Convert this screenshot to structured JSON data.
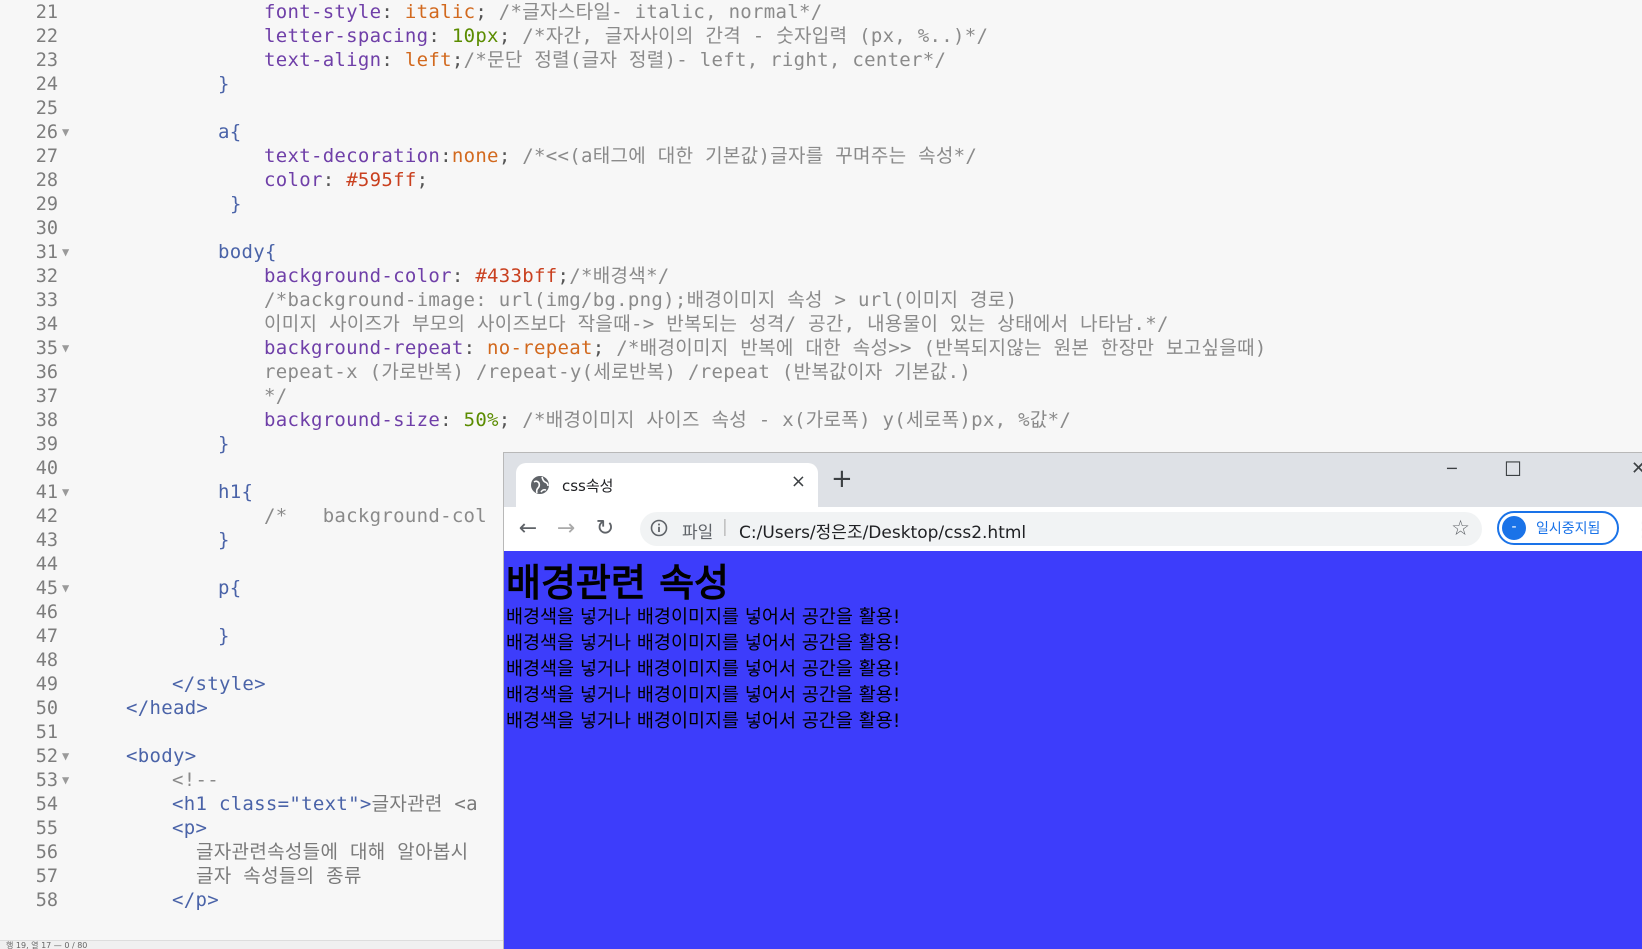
{
  "editor": {
    "lines": [
      {
        "n": "21",
        "fold": false,
        "indent": 264,
        "tokens": [
          [
            "prop",
            "font-style"
          ],
          [
            "p",
            ": "
          ],
          [
            "val",
            "italic"
          ],
          [
            "p",
            "; "
          ],
          [
            "cmt",
            "/*글자스타일- italic, normal*/"
          ]
        ]
      },
      {
        "n": "22",
        "fold": false,
        "indent": 264,
        "tokens": [
          [
            "prop",
            "letter-spacing"
          ],
          [
            "p",
            ": "
          ],
          [
            "num",
            "10px"
          ],
          [
            "p",
            "; "
          ],
          [
            "cmt",
            "/*자간, 글자사이의 간격 - 숫자입력 (px, %..)*/"
          ]
        ]
      },
      {
        "n": "23",
        "fold": false,
        "indent": 264,
        "tokens": [
          [
            "prop",
            "text-align"
          ],
          [
            "p",
            ": "
          ],
          [
            "val",
            "left"
          ],
          [
            "p",
            ";"
          ],
          [
            "cmt",
            "/*문단 정렬(글자 정렬)- left, right, center*/"
          ]
        ]
      },
      {
        "n": "24",
        "fold": false,
        "indent": 218,
        "tokens": [
          [
            "sel",
            "}"
          ]
        ]
      },
      {
        "n": "25",
        "fold": false,
        "indent": 218,
        "tokens": []
      },
      {
        "n": "26",
        "fold": true,
        "indent": 218,
        "tokens": [
          [
            "sel",
            "a{"
          ]
        ]
      },
      {
        "n": "27",
        "fold": false,
        "indent": 264,
        "tokens": [
          [
            "prop",
            "text-decoration"
          ],
          [
            "p",
            ":"
          ],
          [
            "val",
            "none"
          ],
          [
            "p",
            "; "
          ],
          [
            "cmt",
            "/*<<(a태그에 대한 기본값)글자를 꾸며주는 속성*/"
          ]
        ]
      },
      {
        "n": "28",
        "fold": false,
        "indent": 264,
        "tokens": [
          [
            "prop",
            "color"
          ],
          [
            "p",
            ": "
          ],
          [
            "col",
            "#595ff"
          ],
          [
            "p",
            ";"
          ]
        ]
      },
      {
        "n": "29",
        "fold": false,
        "indent": 230,
        "tokens": [
          [
            "sel",
            "}"
          ]
        ]
      },
      {
        "n": "30",
        "fold": false,
        "indent": 218,
        "tokens": []
      },
      {
        "n": "31",
        "fold": true,
        "indent": 218,
        "tokens": [
          [
            "sel",
            "body{"
          ]
        ]
      },
      {
        "n": "32",
        "fold": false,
        "indent": 264,
        "tokens": [
          [
            "prop",
            "background-color"
          ],
          [
            "p",
            ": "
          ],
          [
            "col",
            "#433bff"
          ],
          [
            "p",
            ";"
          ],
          [
            "cmt",
            "/*배경색*/"
          ]
        ]
      },
      {
        "n": "33",
        "fold": false,
        "indent": 264,
        "tokens": [
          [
            "cmt",
            "/*background-image: url(img/bg.png);배경이미지 속성 > url(이미지 경로)"
          ]
        ]
      },
      {
        "n": "34",
        "fold": false,
        "indent": 264,
        "tokens": [
          [
            "cmt",
            "이미지 사이즈가 부모의 사이즈보다 작을때-> 반복되는 성격/ 공간, 내용물이 있는 상태에서 나타남.*/"
          ]
        ]
      },
      {
        "n": "35",
        "fold": true,
        "indent": 264,
        "tokens": [
          [
            "prop",
            "background-repeat"
          ],
          [
            "p",
            ": "
          ],
          [
            "val",
            "no-repeat"
          ],
          [
            "p",
            "; "
          ],
          [
            "cmt",
            "/*배경이미지 반복에 대한 속성>> (반복되지않는 원본 한장만 보고싶을때)"
          ]
        ]
      },
      {
        "n": "36",
        "fold": false,
        "indent": 264,
        "tokens": [
          [
            "cmt",
            "repeat-x (가로반복) /repeat-y(세로반복) /repeat (반복값이자 기본값.)"
          ]
        ]
      },
      {
        "n": "37",
        "fold": false,
        "indent": 264,
        "tokens": [
          [
            "cmt",
            "*/"
          ]
        ]
      },
      {
        "n": "38",
        "fold": false,
        "indent": 264,
        "tokens": [
          [
            "prop",
            "background-size"
          ],
          [
            "p",
            ": "
          ],
          [
            "num",
            "50%"
          ],
          [
            "p",
            "; "
          ],
          [
            "cmt",
            "/*배경이미지 사이즈 속성 - x(가로폭) y(세로폭)px, %값*/"
          ]
        ]
      },
      {
        "n": "39",
        "fold": false,
        "indent": 218,
        "tokens": [
          [
            "sel",
            "}"
          ]
        ]
      },
      {
        "n": "40",
        "fold": false,
        "indent": 218,
        "tokens": []
      },
      {
        "n": "41",
        "fold": true,
        "indent": 218,
        "tokens": [
          [
            "sel",
            "h1{"
          ]
        ]
      },
      {
        "n": "42",
        "fold": false,
        "indent": 264,
        "tokens": [
          [
            "cmt",
            "/*   background-col"
          ]
        ]
      },
      {
        "n": "43",
        "fold": false,
        "indent": 218,
        "tokens": [
          [
            "sel",
            "}"
          ]
        ]
      },
      {
        "n": "44",
        "fold": false,
        "indent": 218,
        "tokens": []
      },
      {
        "n": "45",
        "fold": true,
        "indent": 218,
        "tokens": [
          [
            "sel",
            "p{"
          ]
        ]
      },
      {
        "n": "46",
        "fold": false,
        "indent": 218,
        "tokens": []
      },
      {
        "n": "47",
        "fold": false,
        "indent": 218,
        "tokens": [
          [
            "sel",
            "}"
          ]
        ]
      },
      {
        "n": "48",
        "fold": false,
        "indent": 218,
        "tokens": []
      },
      {
        "n": "49",
        "fold": false,
        "indent": 172,
        "tokens": [
          [
            "tag",
            "</style>"
          ]
        ]
      },
      {
        "n": "50",
        "fold": false,
        "indent": 126,
        "tokens": [
          [
            "tag",
            "</head>"
          ]
        ]
      },
      {
        "n": "51",
        "fold": false,
        "indent": 126,
        "tokens": []
      },
      {
        "n": "52",
        "fold": true,
        "indent": 126,
        "tokens": [
          [
            "tag",
            "<body>"
          ]
        ]
      },
      {
        "n": "53",
        "fold": true,
        "indent": 172,
        "tokens": [
          [
            "cmt",
            "<!--"
          ]
        ]
      },
      {
        "n": "54",
        "fold": false,
        "indent": 172,
        "tokens": [
          [
            "tag",
            "<h1 class=\"text\">"
          ],
          [
            "txt",
            "글자관련 <a"
          ]
        ]
      },
      {
        "n": "55",
        "fold": false,
        "indent": 172,
        "tokens": [
          [
            "tag",
            "<p>"
          ]
        ]
      },
      {
        "n": "56",
        "fold": false,
        "indent": 196,
        "tokens": [
          [
            "txt",
            "글자관련속성들에 대해 알아봅시"
          ]
        ]
      },
      {
        "n": "57",
        "fold": false,
        "indent": 196,
        "tokens": [
          [
            "txt",
            "글자 속성들의 종류"
          ]
        ]
      },
      {
        "n": "58",
        "fold": false,
        "indent": 172,
        "tokens": [
          [
            "tag",
            "</p>"
          ]
        ]
      }
    ]
  },
  "statusbar": {
    "text": "행 19, 열 17 — 0 / 80"
  },
  "browser": {
    "tab_title": "css속성",
    "tab_close": "×",
    "new_tab": "+",
    "minimize": "─",
    "maximize": "☐",
    "close": "✕",
    "back": "←",
    "forward": "→",
    "reload": "↻",
    "scheme_label": "파일",
    "separator": "|",
    "url": "C:/Users/정은조/Desktop/css2.html",
    "star": "☆",
    "profile_initial": "-",
    "profile_label": "일시중지됨",
    "menu": "⋮",
    "page": {
      "heading": "배경관련 속성",
      "paragraphs": [
        "배경색을 넣거나 배경이미지를 넣어서 공간을 활용!",
        "배경색을 넣거나 배경이미지를 넣어서 공간을 활용!",
        "배경색을 넣거나 배경이미지를 넣어서 공간을 활용!",
        "배경색을 넣거나 배경이미지를 넣어서 공간을 활용!",
        "배경색을 넣거나 배경이미지를 넣어서 공간을 활용!"
      ],
      "background_color": "#3d3dfb"
    }
  }
}
